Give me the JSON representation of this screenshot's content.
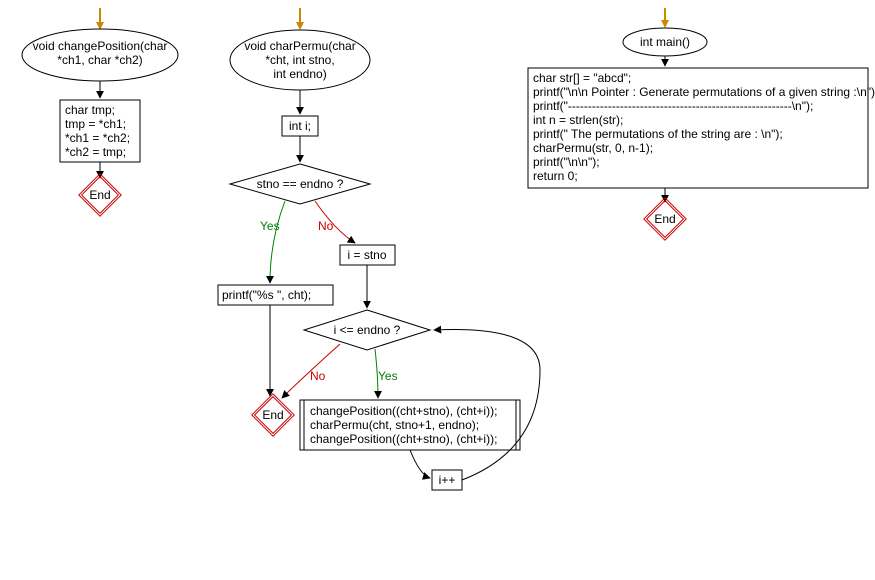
{
  "funcA": {
    "signature_line1": "void changePosition(char",
    "signature_line2": "*ch1, char *ch2)",
    "body_line1": "char tmp;",
    "body_line2": "tmp = *ch1;",
    "body_line3": "*ch1 = *ch2;",
    "body_line4": "*ch2 = tmp;",
    "end": "End"
  },
  "funcB": {
    "signature_line1": "void charPermu(char",
    "signature_line2": "*cht, int stno,",
    "signature_line3": "int endno)",
    "decl": "int i;",
    "cond1": "stno == endno ?",
    "yes": "Yes",
    "no": "No",
    "print": "printf(\"%s  \", cht);",
    "assign": "i = stno",
    "cond2": "i <= endno ?",
    "loop_line1": "changePosition((cht+stno), (cht+i));",
    "loop_line2": "charPermu(cht, stno+1, endno);",
    "loop_line3": "changePosition((cht+stno), (cht+i));",
    "inc": "i++",
    "end": "End"
  },
  "funcC": {
    "signature": "int main()",
    "line1": "char str[] = \"abcd\";",
    "line2": "printf(\"\\n\\n Pointer : Generate permutations of a given string :\\n\");",
    "line3": "printf(\"--------------------------------------------------------\\n\");",
    "line4": "int n = strlen(str);",
    "line5": "printf(\" The permutations of the string are : \\n\");",
    "line6": "charPermu(str, 0, n-1);",
    "line7": "printf(\"\\n\\n\");",
    "line8": "return 0;",
    "end": "End"
  }
}
